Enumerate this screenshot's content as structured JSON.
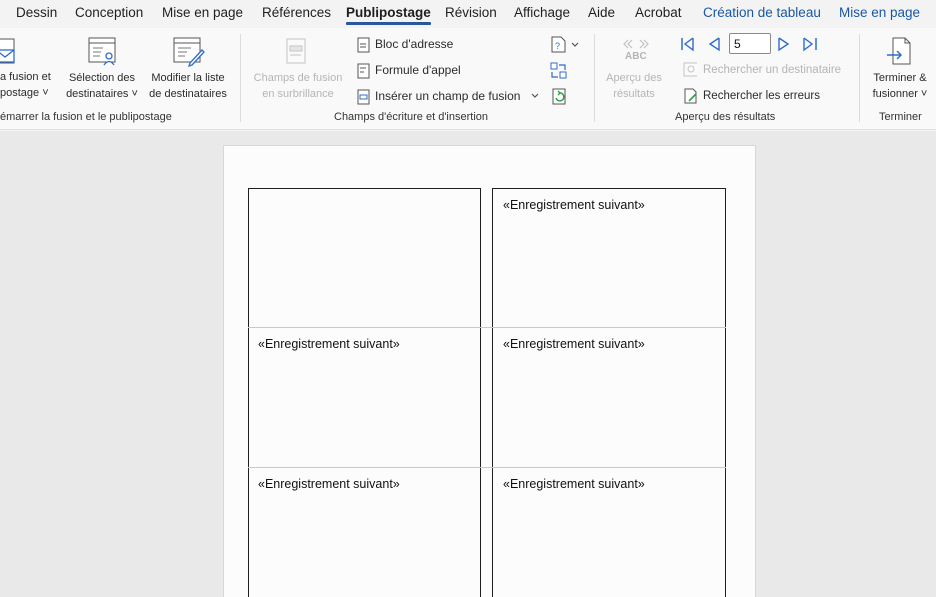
{
  "tabs": [
    {
      "label": "Dessin",
      "active": false,
      "contextual": false
    },
    {
      "label": "Conception",
      "active": false,
      "contextual": false
    },
    {
      "label": "Mise en page",
      "active": false,
      "contextual": false
    },
    {
      "label": "Références",
      "active": false,
      "contextual": false
    },
    {
      "label": "Publipostage",
      "active": true,
      "contextual": false
    },
    {
      "label": "Révision",
      "active": false,
      "contextual": false
    },
    {
      "label": "Affichage",
      "active": false,
      "contextual": false
    },
    {
      "label": "Aide",
      "active": false,
      "contextual": false
    },
    {
      "label": "Acrobat",
      "active": false,
      "contextual": false
    },
    {
      "label": "Création de tableau",
      "active": false,
      "contextual": true
    },
    {
      "label": "Mise en page",
      "active": false,
      "contextual": true
    }
  ],
  "ribbon": {
    "start_merge": {
      "start_btn_line1": "a fusion et",
      "start_btn_line2": "postage ˅",
      "select_line1": "Sélection des",
      "select_line2": "destinataires ˅",
      "edit_line1": "Modifier la liste",
      "edit_line2": "de destinataires",
      "group_name": "émarrer la fusion et le publipostage"
    },
    "write_insert": {
      "highlight_line1": "Champs de fusion",
      "highlight_line2": "en surbrillance",
      "address_block": "Bloc d'adresse",
      "greeting_line": "Formule d'appel",
      "insert_field": "Insérer un champ de fusion",
      "group_name": "Champs d'écriture et d'insertion"
    },
    "preview": {
      "preview_line1": "Aperçu des",
      "preview_line2": "résultats",
      "abc_label": "ABC",
      "record_number": "5",
      "find_recipient": "Rechercher un destinataire",
      "check_errors": "Rechercher les erreurs",
      "group_name": "Aperçu des résultats"
    },
    "finish": {
      "finish_line1": "Terminer &",
      "finish_line2": "fusionner ˅",
      "group_name": "Terminer"
    }
  },
  "document": {
    "cells": [
      {
        "text": ""
      },
      {
        "text": "«Enregistrement suivant»"
      },
      {
        "text": "«Enregistrement suivant»"
      },
      {
        "text": "«Enregistrement suivant»"
      },
      {
        "text": "«Enregistrement suivant»"
      },
      {
        "text": "«Enregistrement suivant»"
      }
    ]
  },
  "colors": {
    "accent": "#2b579a",
    "contextual_tab": "#1957a6",
    "icon_blue": "#2f6cc9",
    "disabled": "#b5b5b5"
  }
}
